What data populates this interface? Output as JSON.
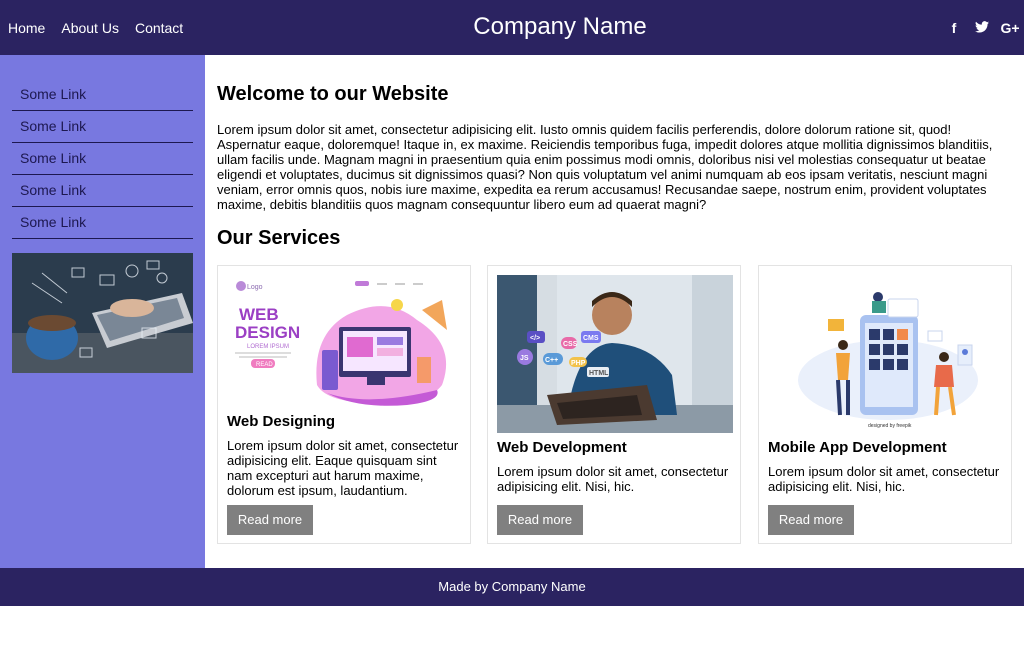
{
  "topnav": {
    "links": [
      "Home",
      "About Us",
      "Contact"
    ]
  },
  "brand": {
    "name": "Company Name"
  },
  "social": {
    "icons": [
      "facebook-icon",
      "twitter-icon",
      "google-plus-icon"
    ],
    "labels": [
      "f",
      "t",
      "G+"
    ]
  },
  "sidebar": {
    "links": [
      "Some Link",
      "Some Link",
      "Some Link",
      "Some Link",
      "Some Link"
    ]
  },
  "main": {
    "heading": "Welcome to our Website",
    "intro": "Lorem ipsum dolor sit amet, consectetur adipisicing elit. Iusto omnis quidem facilis perferendis, dolore dolorum ratione sit, quod! Aspernatur eaque, doloremque! Itaque in, ex maxime. Reiciendis temporibus fuga, impedit dolores atque mollitia dignissimos blanditiis, ullam facilis unde. Magnam magni in praesentium quia enim possimus modi omnis, doloribus nisi vel molestias consequatur ut beatae eligendi et voluptates, ducimus sit dignissimos quasi? Non quis voluptatum vel animi numquam ab eos ipsam veritatis, nesciunt magni veniam, error omnis quos, nobis iure maxime, expedita ea rerum accusamus! Recusandae saepe, nostrum enim, provident voluptates maxime, debitis blanditiis quos magnam consequuntur libero eum ad quaerat magni?",
    "services_heading": "Our Services"
  },
  "services": [
    {
      "title": "Web Designing",
      "text": "Lorem ipsum dolor sit amet, consectetur adipisicing elit. Eaque quisquam sint nam excepturi aut harum maxime, dolorum est ipsum, laudantium.",
      "button": "Read more",
      "image_text": {
        "logo": "Logo",
        "line1": "WEB",
        "line2": "DESIGN",
        "sub": "LOREM IPSUM",
        "btn": "READ"
      }
    },
    {
      "title": "Web Development",
      "text": "Lorem ipsum dolor sit amet, consectetur adipisicing elit. Nisi, hic.",
      "button": "Read more",
      "image_text": {
        "tags": [
          "</>",
          "CSS",
          "CMS",
          "JS",
          "C++",
          "PHP",
          "HTML"
        ]
      }
    },
    {
      "title": "Mobile App Development",
      "text": "Lorem ipsum dolor sit amet, consectetur adipisicing elit. Nisi, hic.",
      "button": "Read more",
      "image_text": {
        "credit": "designed by freepik"
      }
    }
  ],
  "footer": {
    "text": "Made by Company Name"
  },
  "colors": {
    "header": "#2b2361",
    "sidebar": "#7878e0",
    "button": "#808080",
    "sidebar_text": "#1d1850"
  }
}
